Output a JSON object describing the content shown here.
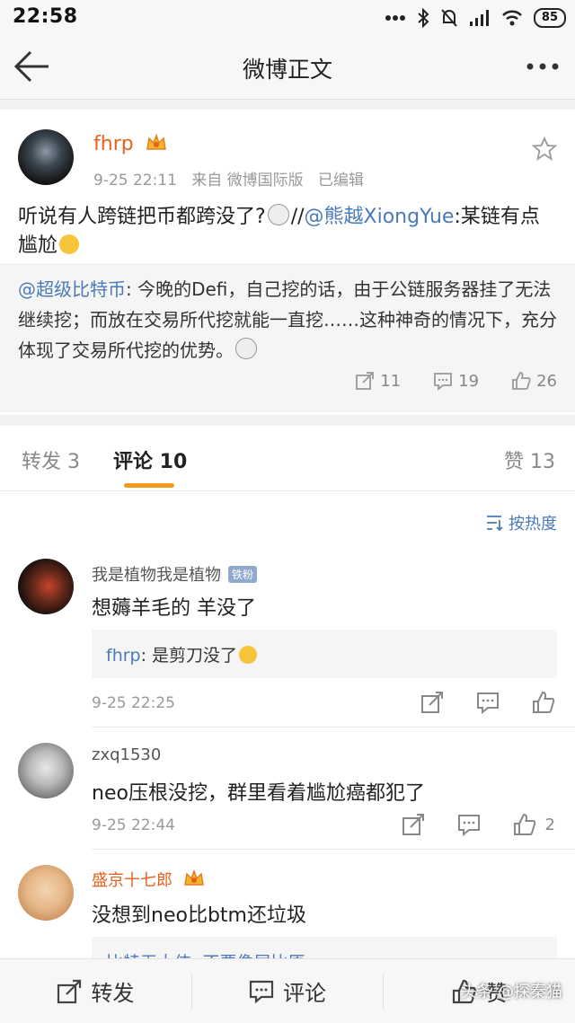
{
  "status_bar": {
    "time": "22:58",
    "battery": "85"
  },
  "nav": {
    "title": "微博正文"
  },
  "post": {
    "author": "fhrp",
    "time": "9-25 22:11",
    "source": "来自 微博国际版",
    "edited": "已编辑",
    "text_part1": "听说有人跨链把币都跨没了?",
    "text_sep": "//",
    "text_mention": "@熊越XiongYue",
    "text_part2": ":某链有点尴尬",
    "repost_mention": "@超级比特币",
    "repost_text": ": 今晚的Defi，自己挖的话，由于公链服务器挂了无法继续挖；而放在交易所代挖就能一直挖……这种神奇的情况下，充分体现了交易所代挖的优势。",
    "reposts": "11",
    "comments": "19",
    "likes": "26"
  },
  "tabs": {
    "repost": "转发 3",
    "comment": "评论 10",
    "like": "赞 13"
  },
  "sort_label": "按热度",
  "comments": [
    {
      "name": "我是植物我是植物",
      "badge": "铁粉",
      "text": "想薅羊毛的 羊没了",
      "reply_name": "fhrp",
      "reply_text": ": 是剪刀没了",
      "time": "9-25 22:25",
      "likes": ""
    },
    {
      "name": "zxq1530",
      "text": "neo压根没挖，群里看着尴尬癌都犯了",
      "time": "9-25 22:44",
      "likes": "2"
    },
    {
      "name": "盛京十七郎",
      "text": "没想到neo比btm还垃圾",
      "reply_partial": "比特无大侠: 不要像尾比原"
    }
  ],
  "bottom_bar": {
    "repost": "转发",
    "comment": "评论",
    "like": "赞"
  },
  "watermark": "头条 @探秦猫",
  "colors": {
    "accent": "#f29c1f",
    "link": "#4a7ab9",
    "vip": "#e8611e"
  }
}
